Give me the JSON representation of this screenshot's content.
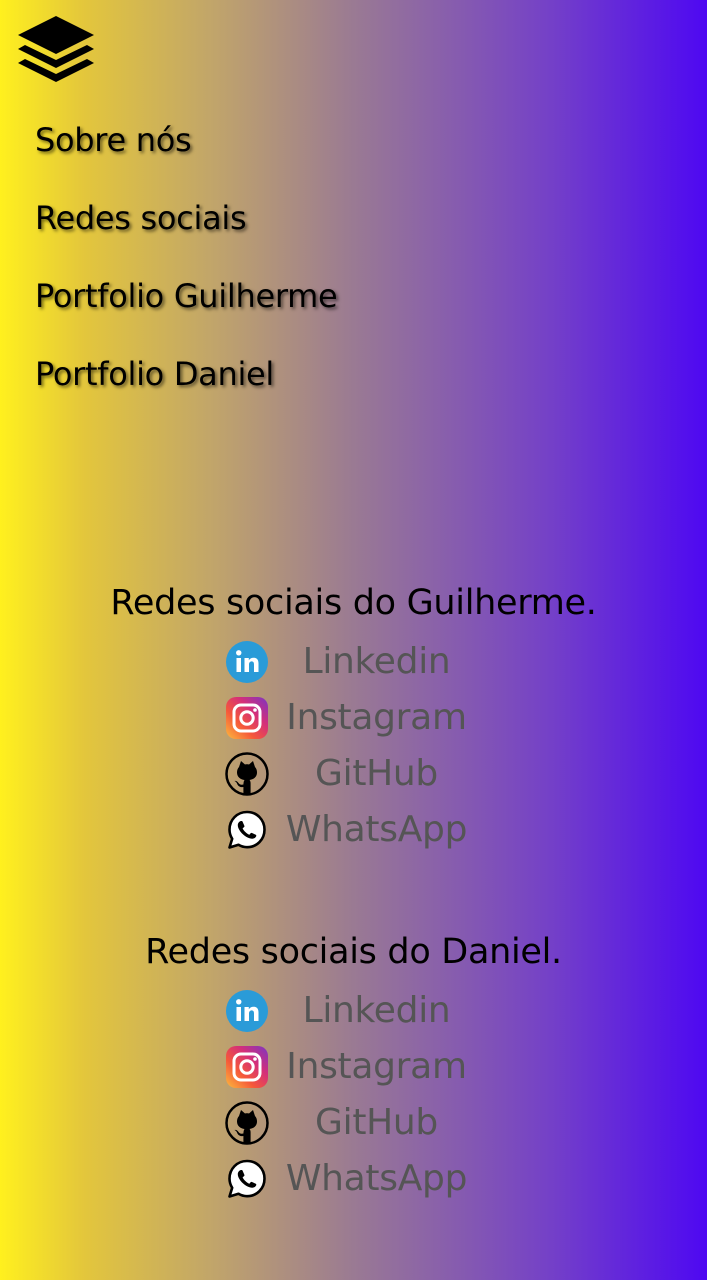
{
  "menu": {
    "icon": "layers-icon",
    "items": [
      {
        "label": "Sobre nós"
      },
      {
        "label": "Redes sociais"
      },
      {
        "label": "Portfolio Guilherme"
      },
      {
        "label": "Portfolio Daniel"
      }
    ]
  },
  "sections": [
    {
      "title": "Redes sociais do Guilherme.",
      "links": [
        {
          "label": "Linkedin",
          "icon": "linkedin-icon"
        },
        {
          "label": "Instagram",
          "icon": "instagram-icon"
        },
        {
          "label": "GitHub",
          "icon": "github-icon"
        },
        {
          "label": "WhatsApp",
          "icon": "whatsapp-icon"
        }
      ]
    },
    {
      "title": "Redes sociais do Daniel.",
      "links": [
        {
          "label": "Linkedin",
          "icon": "linkedin-icon"
        },
        {
          "label": "Instagram",
          "icon": "instagram-icon"
        },
        {
          "label": "GitHub",
          "icon": "github-icon"
        },
        {
          "label": "WhatsApp",
          "icon": "whatsapp-icon"
        }
      ]
    }
  ],
  "colors": {
    "gradient_start": "#fff01e",
    "gradient_end": "#4e08f2",
    "link_text": "#555555",
    "linkedin_blue": "#2a9bd8"
  }
}
